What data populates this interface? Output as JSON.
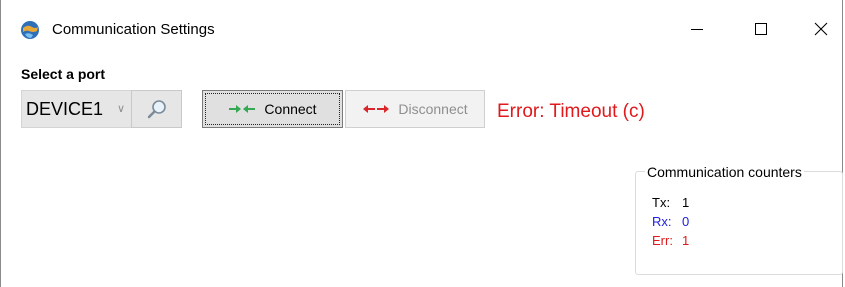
{
  "window": {
    "title": "Communication Settings",
    "controls": {
      "minimize": "minimize-icon",
      "maximize": "maximize-icon",
      "close": "close-icon"
    }
  },
  "port": {
    "label": "Select a port",
    "selected": "DEVICE1",
    "search_icon": "search-icon"
  },
  "buttons": {
    "connect": "Connect",
    "disconnect": "Disconnect"
  },
  "status": {
    "error": "Error: Timeout (c)",
    "error_color": "#e0191d"
  },
  "counters": {
    "title": "Communication counters",
    "tx_label": "Tx:",
    "tx_value": "1",
    "rx_label": "Rx:",
    "rx_value": "0",
    "err_label": "Err:",
    "err_value": "1",
    "tx_color": "#000000",
    "rx_color": "#2020e0",
    "err_color": "#e0191d"
  }
}
